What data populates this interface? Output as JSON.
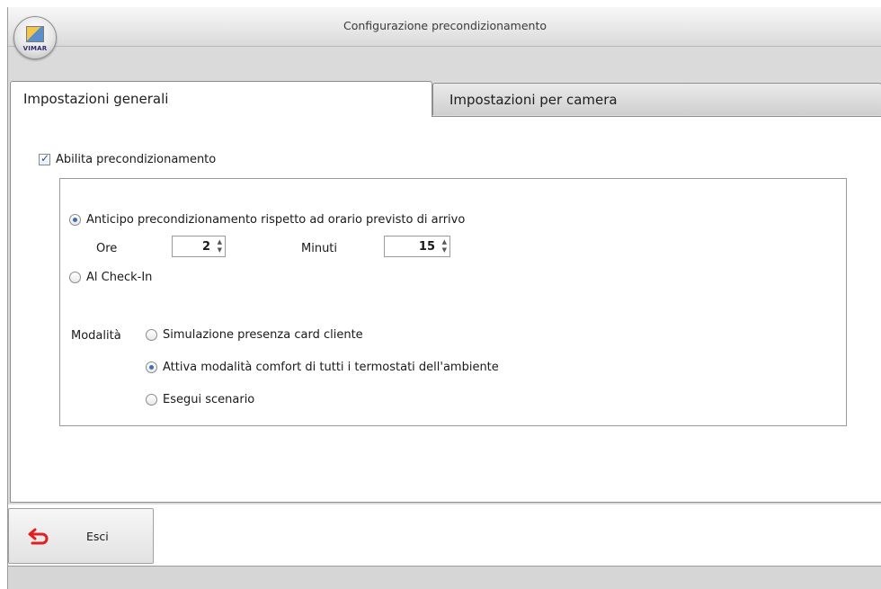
{
  "window": {
    "title": "Configurazione precondizionamento"
  },
  "logo": {
    "text": "VIMAR"
  },
  "tabs": [
    {
      "label": "Impostazioni generali",
      "active": true
    },
    {
      "label": "Impostazioni per camera",
      "active": false
    }
  ],
  "general": {
    "enable_label": "Abilita precondizionamento",
    "enable_checked": true,
    "options": {
      "advance_label": "Anticipo precondizionamento rispetto ad orario previsto di arrivo",
      "advance_selected": true,
      "hours_label": "Ore",
      "hours_value": "2",
      "minutes_label": "Minuti",
      "minutes_value": "15",
      "checkin_label": "Al Check-In",
      "checkin_selected": false
    },
    "mode": {
      "label": "Modalità",
      "options": [
        {
          "label": "Simulazione presenza card cliente",
          "selected": false
        },
        {
          "label": "Attiva modalità comfort di tutti i termostati dell'ambiente",
          "selected": true
        },
        {
          "label": "Esegui scenario",
          "selected": false
        }
      ]
    }
  },
  "footer": {
    "exit_label": "Esci",
    "exit_icon": "undo-arrow-icon",
    "accent": "#e21f1f"
  }
}
